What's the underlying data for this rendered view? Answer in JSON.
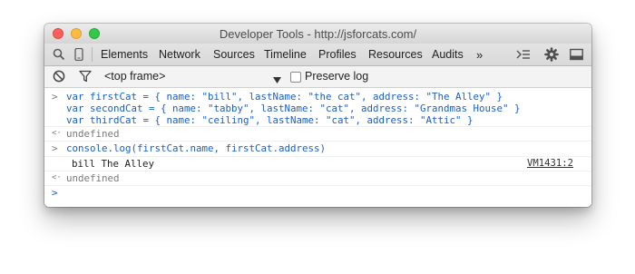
{
  "window": {
    "title": "Developer Tools - http://jsforcats.com/"
  },
  "tabs": [
    {
      "label": "Elements"
    },
    {
      "label": "Network"
    },
    {
      "label": "Sources"
    },
    {
      "label": "Timeline"
    },
    {
      "label": "Profiles"
    },
    {
      "label": "Resources"
    },
    {
      "label": "Audits"
    }
  ],
  "tabs_overflow": "»",
  "toolbar": {
    "frame_select": "<top frame>",
    "preserve_log_label": "Preserve log",
    "preserve_log_checked": false
  },
  "console": {
    "input1": [
      "var firstCat = { name: \"bill\", lastName: \"the cat\", address: \"The Alley\" }",
      "var secondCat = { name: \"tabby\", lastName: \"cat\", address: \"Grandmas House\" }",
      "var thirdCat = { name: \"ceiling\", lastName: \"cat\", address: \"Attic\" }"
    ],
    "result1": "undefined",
    "input2": "console.log(firstCat.name, firstCat.address)",
    "log_output": "bill The Alley",
    "log_source": "VM1431:2",
    "result2": "undefined",
    "prompt_symbol": ">",
    "result_symbol": "<·"
  }
}
